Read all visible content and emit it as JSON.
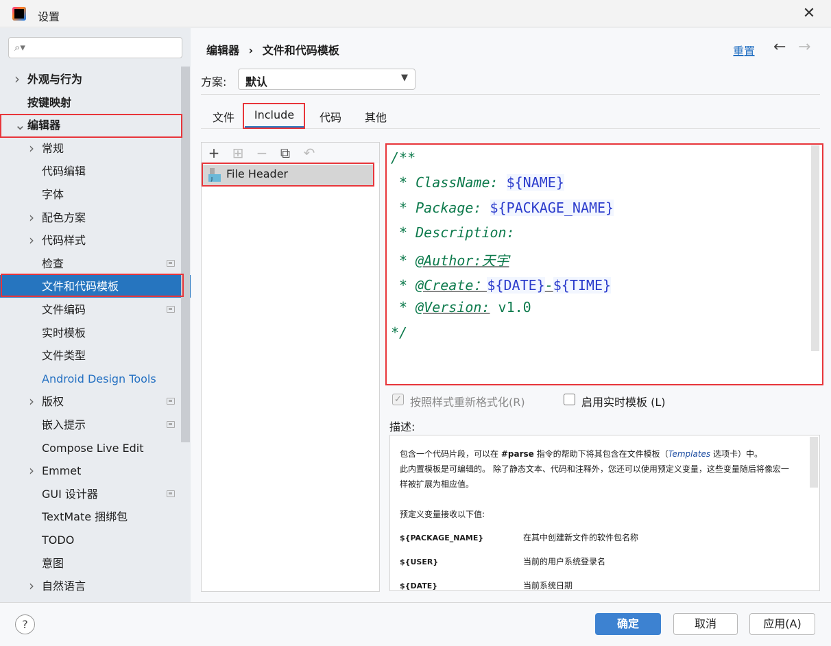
{
  "window": {
    "title": "设置",
    "close": "✕"
  },
  "sidebar": {
    "items": [
      {
        "label": "外观与行为",
        "level": 0,
        "chevron": true
      },
      {
        "label": "按键映射",
        "level": 0,
        "chevron": false
      },
      {
        "label": "编辑器",
        "level": 0,
        "chevron": "down"
      },
      {
        "label": "常规",
        "level": 1,
        "chevron": true
      },
      {
        "label": "代码编辑",
        "level": 1
      },
      {
        "label": "字体",
        "level": 1
      },
      {
        "label": "配色方案",
        "level": 1,
        "chevron": true
      },
      {
        "label": "代码样式",
        "level": 1,
        "chevron": true
      },
      {
        "label": "检查",
        "level": 1,
        "gear": true
      },
      {
        "label": "文件和代码模板",
        "level": 1,
        "selected": true
      },
      {
        "label": "文件编码",
        "level": 1,
        "gear": true
      },
      {
        "label": "实时模板",
        "level": 1
      },
      {
        "label": "文件类型",
        "level": 1
      },
      {
        "label": "Android Design Tools",
        "level": 1,
        "link": true
      },
      {
        "label": "版权",
        "level": 1,
        "chevron": true,
        "gear": true
      },
      {
        "label": "嵌入提示",
        "level": 1,
        "gear": true
      },
      {
        "label": "Compose Live Edit",
        "level": 1
      },
      {
        "label": "Emmet",
        "level": 1,
        "chevron": true
      },
      {
        "label": "GUI 设计器",
        "level": 1,
        "gear": true
      },
      {
        "label": "TextMate 捆绑包",
        "level": 1
      },
      {
        "label": "TODO",
        "level": 1
      },
      {
        "label": "意图",
        "level": 1
      },
      {
        "label": "自然语言",
        "level": 1,
        "chevron": true
      }
    ]
  },
  "header": {
    "breadcrumb": [
      "编辑器",
      "文件和代码模板"
    ],
    "separator": "›",
    "reset": "重置"
  },
  "scheme": {
    "label": "方案:",
    "value": "默认"
  },
  "tabs": [
    "文件",
    "Include",
    "代码",
    "其他"
  ],
  "list": {
    "items": [
      "File Header"
    ]
  },
  "editor": {
    "lines": [
      [
        {
          "t": "/**"
        }
      ],
      [
        {
          "t": " * ClassName: "
        },
        {
          "t": "${NAME}",
          "v": true
        }
      ],
      [
        {
          "t": " * Package: "
        },
        {
          "t": "${PACKAGE_NAME}",
          "v": true
        }
      ],
      [
        {
          "t": " * Description:"
        }
      ],
      [
        {
          "t": " * "
        },
        {
          "t": "@Author:天宇",
          "u": true
        }
      ],
      [
        {
          "t": " * "
        },
        {
          "t": "@Create：",
          "u": true
        },
        {
          "t": "${DATE}",
          "v": true
        },
        {
          "t": "-",
          "u": true
        },
        {
          "t": "${TIME}",
          "v": true
        }
      ],
      [
        {
          "t": " * "
        },
        {
          "t": "@Version:",
          "u": true
        },
        {
          "t": " v1.0"
        }
      ],
      [
        {
          "t": "*/"
        }
      ]
    ]
  },
  "options": {
    "reformat": {
      "label": "按照样式重新格式化(R)",
      "checked": true,
      "disabled": true
    },
    "live_templates": {
      "label": "启用实时模板 (L)",
      "checked": false
    }
  },
  "description": {
    "label": "描述:",
    "p1a": "包含一个代码片段，可以在 ",
    "p1b": "#parse",
    "p1c": " 指令的帮助下将其包含在文件模板（",
    "p1d": "Templates",
    "p1e": " 选项卡）中。",
    "p2": "此内置模板是可编辑的。 除了静态文本、代码和注释外，您还可以使用预定义变量，这些变量随后将像宏一样被扩展为相应值。",
    "p3": "预定义变量接收以下值:",
    "vars": [
      {
        "name": "${PACKAGE_NAME}",
        "desc": "在其中创建新文件的软件包名称"
      },
      {
        "name": "${USER}",
        "desc": "当前的用户系统登录名"
      },
      {
        "name": "${DATE}",
        "desc": "当前系统日期"
      }
    ]
  },
  "footer": {
    "help": "?",
    "ok": "确定",
    "cancel": "取消",
    "apply": "应用(A)"
  },
  "colors": {
    "accent": "#2675bf",
    "highlight": "#e8353a",
    "comment": "#0d7a4c",
    "variable": "#2b3ccc"
  }
}
